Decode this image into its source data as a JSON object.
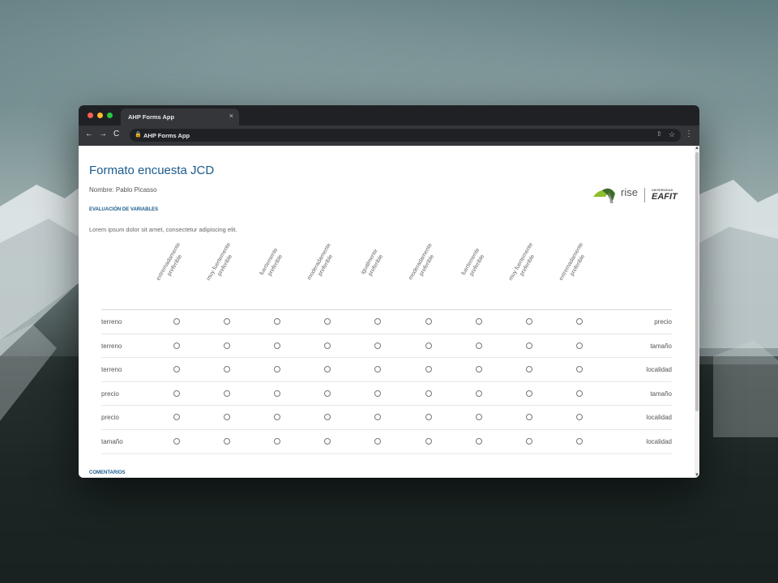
{
  "browser": {
    "tab_title": "AHP Forms App",
    "tab_close": "×",
    "url": "AHP Forms App",
    "nav_back": "←",
    "nav_forward": "→",
    "nav_reload": "C",
    "icons": [
      "back-arrow-icon",
      "forward-arrow-icon",
      "reload-icon",
      "lock-icon",
      "share-icon",
      "star-icon",
      "kebab-menu-icon"
    ]
  },
  "page": {
    "title": "Formato encuesta JCD",
    "name_line": "Nombre: Pablo Picasso",
    "section_variables": "EVALUACIÓN DE VARIABLES",
    "description": "Lorem ipsum dolor sit amet, consectetur adipiscing elit.",
    "section_comments": "COMENTARIOS",
    "logo": {
      "rise": "rise",
      "uni_small": "UNIVERSIDAD",
      "eafit": "EAFIT"
    }
  },
  "scale": [
    {
      "l1": "extremadamente",
      "l2": "preferible"
    },
    {
      "l1": "muy fuertemente",
      "l2": "preferible"
    },
    {
      "l1": "fuertemente",
      "l2": "preferible"
    },
    {
      "l1": "moderadamente",
      "l2": "preferible"
    },
    {
      "l1": "igualmente",
      "l2": "preferible"
    },
    {
      "l1": "moderadamente",
      "l2": "preferible"
    },
    {
      "l1": "fuertemente",
      "l2": "preferible"
    },
    {
      "l1": "muy fuertemente",
      "l2": "preferible"
    },
    {
      "l1": "extremadamente",
      "l2": "preferible"
    }
  ],
  "comparisons": [
    {
      "left": "terreno",
      "right": "precio"
    },
    {
      "left": "terreno",
      "right": "tamaño"
    },
    {
      "left": "terreno",
      "right": "localidad"
    },
    {
      "left": "precio",
      "right": "tamaño"
    },
    {
      "left": "precio",
      "right": "localidad"
    },
    {
      "left": "tamaño",
      "right": "localidad"
    }
  ],
  "colors": {
    "title_blue": "#1a5b8c",
    "logo_green": "#8dbf2d",
    "logo_dark_green": "#3f6b2a"
  }
}
